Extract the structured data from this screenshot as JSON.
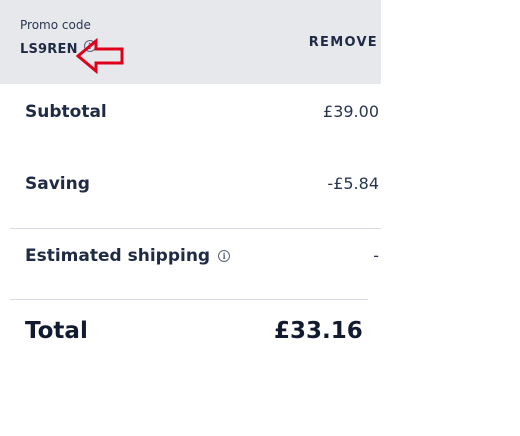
{
  "promo": {
    "label": "Promo code",
    "code": "LS9REN",
    "info_glyph": "i",
    "remove_label": "REMOVE"
  },
  "summary": {
    "subtotal": {
      "label": "Subtotal",
      "value": "£39.00"
    },
    "saving": {
      "label": "Saving",
      "value": "-£5.84"
    },
    "shipping": {
      "label": "Estimated shipping",
      "value": "-",
      "info_glyph": "i"
    },
    "total": {
      "label": "Total",
      "value": "£33.16"
    }
  },
  "colors": {
    "promo_background": "#e6e8ec",
    "text": "#1f2a44",
    "annotation_arrow": "#e0001b"
  },
  "icons": [
    "info-icon",
    "red-arrow-annotation"
  ]
}
